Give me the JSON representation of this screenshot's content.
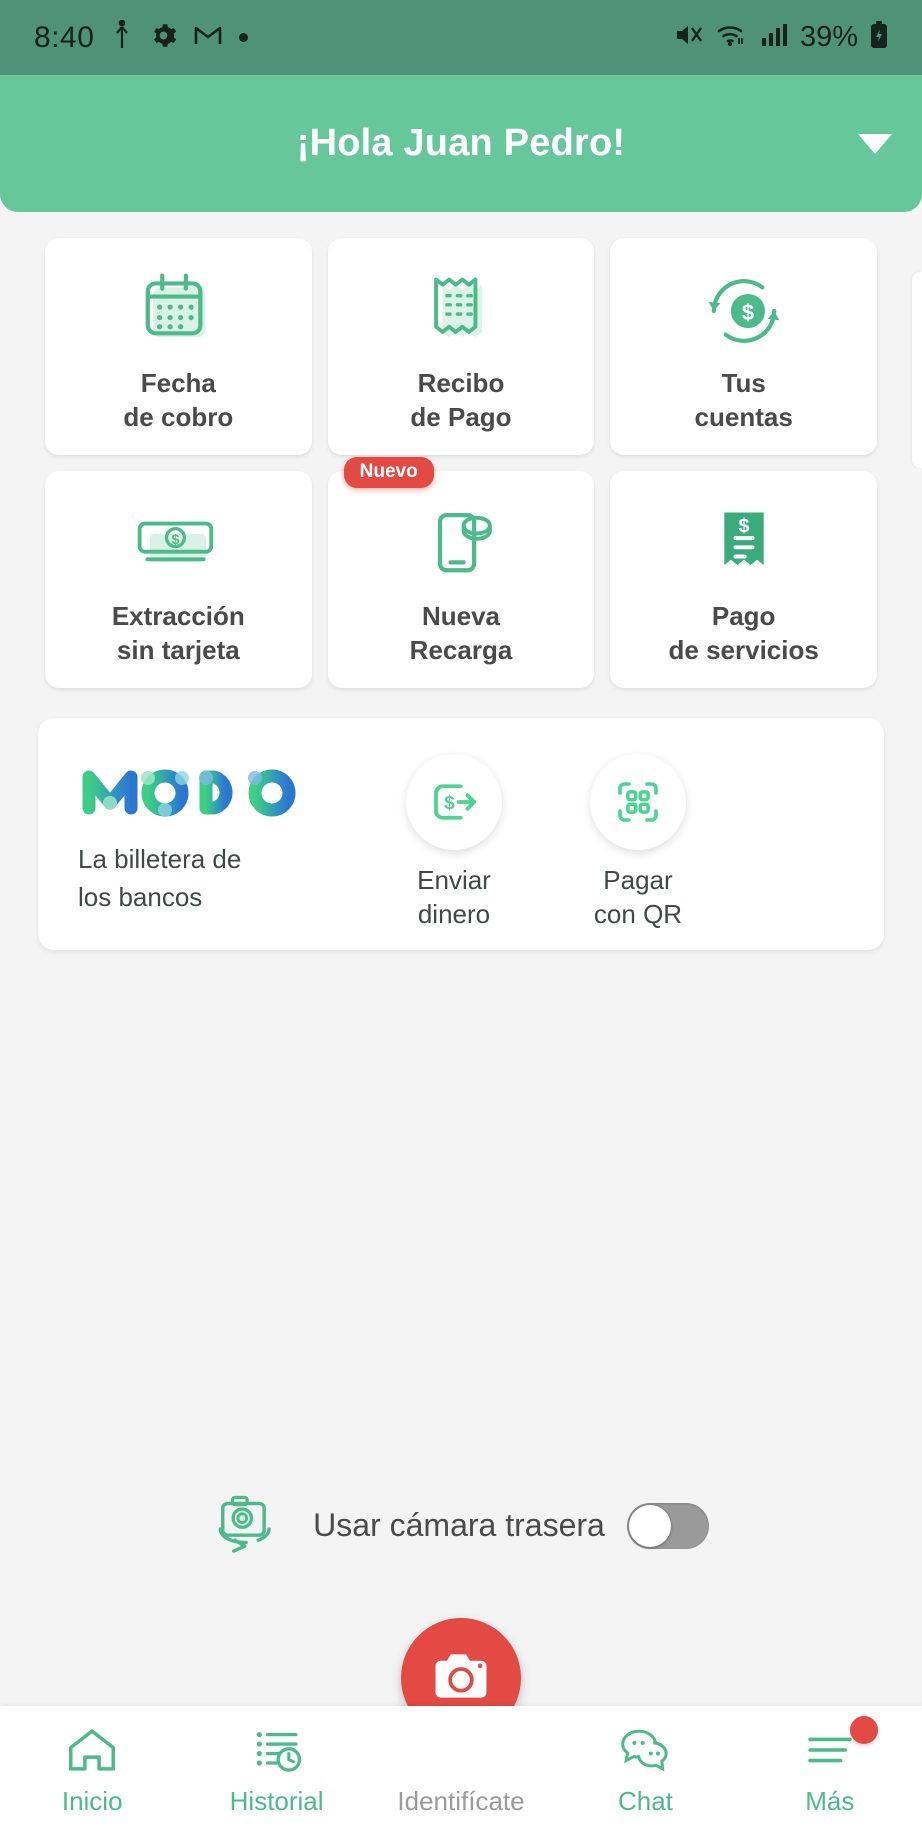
{
  "status_bar": {
    "time": "8:40",
    "battery_percent": "39%",
    "icons": [
      "usb-icon",
      "gear-icon",
      "gmail-icon",
      "dot-icon",
      "mute-icon",
      "wifi-icon",
      "cellular-signal-icon",
      "battery-charging-icon"
    ]
  },
  "header": {
    "greeting": "¡Hola Juan Pedro!",
    "caret": "chevron-down-icon",
    "bg_color": "#66c79b"
  },
  "tiles": [
    {
      "id": "fecha-de-cobro",
      "line1": "Fecha",
      "line2": "de cobro",
      "icon": "calendar-icon",
      "badge": null
    },
    {
      "id": "recibo-de-pago",
      "line1": "Recibo",
      "line2": "de Pago",
      "icon": "receipt-icon",
      "badge": null
    },
    {
      "id": "tus-cuentas",
      "line1": "Tus",
      "line2": "cuentas",
      "icon": "refresh-money-icon",
      "badge": null
    },
    {
      "id": "extraccion-sin-tarjeta",
      "line1": "Extracción",
      "line2": "sin tarjeta",
      "icon": "cash-withdrawal-icon",
      "badge": null
    },
    {
      "id": "nueva-recarga",
      "line1": "Nueva",
      "line2": "Recarga",
      "icon": "phone-topup-icon",
      "badge": "Nuevo"
    },
    {
      "id": "pago-de-servicios",
      "line1": "Pago",
      "line2": "de servicios",
      "icon": "bill-icon",
      "badge": null
    }
  ],
  "modo_card": {
    "logo_text": "MODO",
    "tagline_line1": "La billetera de",
    "tagline_line2": "los bancos",
    "actions": [
      {
        "id": "enviar-dinero",
        "line1": "Enviar",
        "line2": "dinero",
        "icon": "send-money-icon"
      },
      {
        "id": "pagar-con-qr",
        "line1": "Pagar",
        "line2": "con QR",
        "icon": "qr-code-icon"
      }
    ]
  },
  "camera_toggle": {
    "label": "Usar cámara trasera",
    "icon": "camera-rotate-icon",
    "enabled": false
  },
  "bottom_nav": [
    {
      "id": "inicio",
      "label": "Inicio",
      "icon": "home-icon",
      "active": true,
      "badge": false
    },
    {
      "id": "historial",
      "label": "Historial",
      "icon": "history-icon",
      "active": true,
      "badge": false
    },
    {
      "id": "identificate",
      "label": "Identifícate",
      "icon": "camera-icon",
      "active": false,
      "badge": false
    },
    {
      "id": "chat",
      "label": "Chat",
      "icon": "chat-icon",
      "active": true,
      "badge": false
    },
    {
      "id": "mas",
      "label": "Más",
      "icon": "menu-icon",
      "active": true,
      "badge": true
    }
  ],
  "colors": {
    "status_bar": "#4e9278",
    "header": "#66c79b",
    "accent_green": "#4dba8c",
    "accent_red": "#e24a43",
    "page_bg": "#f4f4f4",
    "text_dark": "#4a4a4a"
  }
}
